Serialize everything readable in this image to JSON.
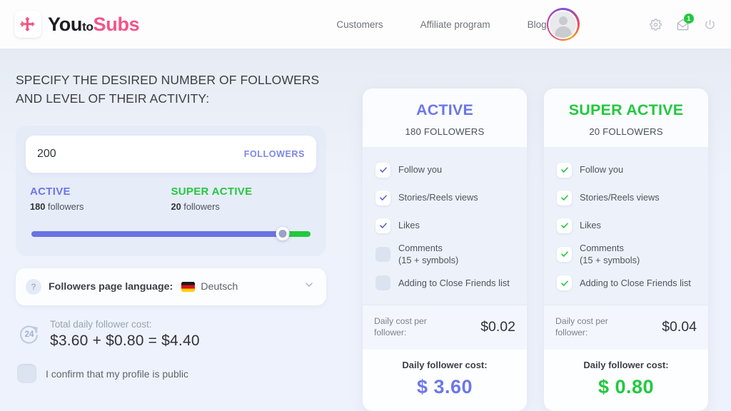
{
  "brand": {
    "logo_icon": "arrow-cross-logo-icon",
    "word_you": "You",
    "word_to": "to",
    "word_subs": "Subs",
    "pink": "#f4538a"
  },
  "nav": {
    "items": [
      {
        "label": "Customers",
        "name": "nav-customers"
      },
      {
        "label": "Affiliate program",
        "name": "nav-affiliate-program"
      },
      {
        "label": "Blog",
        "name": "nav-blog"
      }
    ]
  },
  "header_right": {
    "avatar_icon": "user-avatar-icon",
    "gear_icon": "gear-icon",
    "mail_icon": "mail-icon",
    "power_icon": "power-icon",
    "mail_badge": "1",
    "badge_color": "#22c93f"
  },
  "left": {
    "headline": "SPECIFY THE DESIRED NUMBER OF FOLLOWERS AND LEVEL OF THEIR ACTIVITY:",
    "followers_input": {
      "value": "200",
      "placeholder": "200",
      "suffix": "FOLLOWERS"
    },
    "levels": [
      {
        "title": "ACTIVE",
        "count": "180",
        "unit": "followers",
        "color": "#6c77e8"
      },
      {
        "title": "SUPER ACTIVE",
        "count": "20",
        "unit": "followers",
        "color": "#22c93f"
      }
    ],
    "slider": {
      "percent": 90,
      "fill_color": "#6c72e0",
      "rest_color": "#22c93f",
      "handle_icon": "slider-handle-icon"
    },
    "language": {
      "help_icon": "question-mark-icon",
      "label": "Followers page language:",
      "flag_icon": "germany-flag-icon",
      "value": "Deutsch",
      "chevron_icon": "chevron-down-icon"
    },
    "total": {
      "icon": "24-hours-icon",
      "icon_text": "24",
      "label": "Total daily follower cost:",
      "value": "$3.60 + $0.80 = $4.40"
    },
    "confirm": {
      "checked": false,
      "label": "I confirm that my profile is public"
    }
  },
  "plans": [
    {
      "name": "active",
      "title": "ACTIVE",
      "color": "#6c77e8",
      "count": "180 FOLLOWERS",
      "features": [
        {
          "label": "Follow you",
          "checked": true
        },
        {
          "label": "Stories/Reels views",
          "checked": true
        },
        {
          "label": "Likes",
          "checked": true
        },
        {
          "label": "Comments\n(15 + symbols)",
          "checked": false
        },
        {
          "label": "Adding to Close Friends list",
          "checked": false
        }
      ],
      "per_follower_label": "Daily cost per follower:",
      "per_follower_value": "$0.02",
      "total_label": "Daily follower cost:",
      "total_value": "$ 3.60"
    },
    {
      "name": "super-active",
      "title": "SUPER ACTIVE",
      "color": "#22c93f",
      "count": "20 FOLLOWERS",
      "features": [
        {
          "label": "Follow you",
          "checked": true
        },
        {
          "label": "Stories/Reels views",
          "checked": true
        },
        {
          "label": "Likes",
          "checked": true
        },
        {
          "label": "Comments\n(15 + symbols)",
          "checked": true
        },
        {
          "label": "Adding to Close Friends list",
          "checked": true
        }
      ],
      "per_follower_label": "Daily cost per follower:",
      "per_follower_value": "$0.04",
      "total_label": "Daily follower cost:",
      "total_value": "$ 0.80"
    }
  ]
}
